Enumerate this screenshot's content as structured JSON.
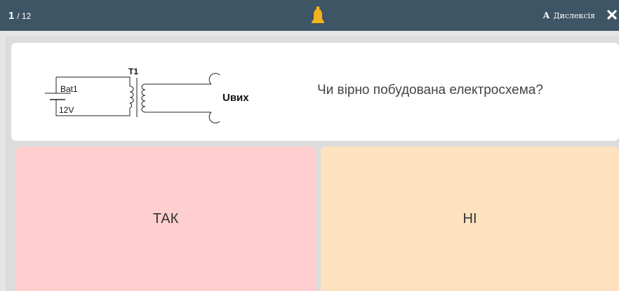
{
  "header": {
    "current_question": "1",
    "total_questions": "/ 12",
    "bell_icon": "bell-icon",
    "dyslexia_glyph": "A",
    "dyslexia_label": "Дислексія",
    "close_icon": "close-icon"
  },
  "question": {
    "text": "Чи вірно побудована електросхема?",
    "schematic": {
      "transformer_label": "T1",
      "battery_label": "Bat1",
      "voltage_label": "12V",
      "output_label": "Uвих"
    }
  },
  "answers": [
    {
      "label": "ТАК",
      "color": "#ffcfcf"
    },
    {
      "label": "НІ",
      "color": "#fee2bf"
    }
  ],
  "colors": {
    "header_bg": "#3e5565",
    "bell": "#f3b31c",
    "card_bg": "#ffffff",
    "page_bg": "#e5e5e5"
  }
}
